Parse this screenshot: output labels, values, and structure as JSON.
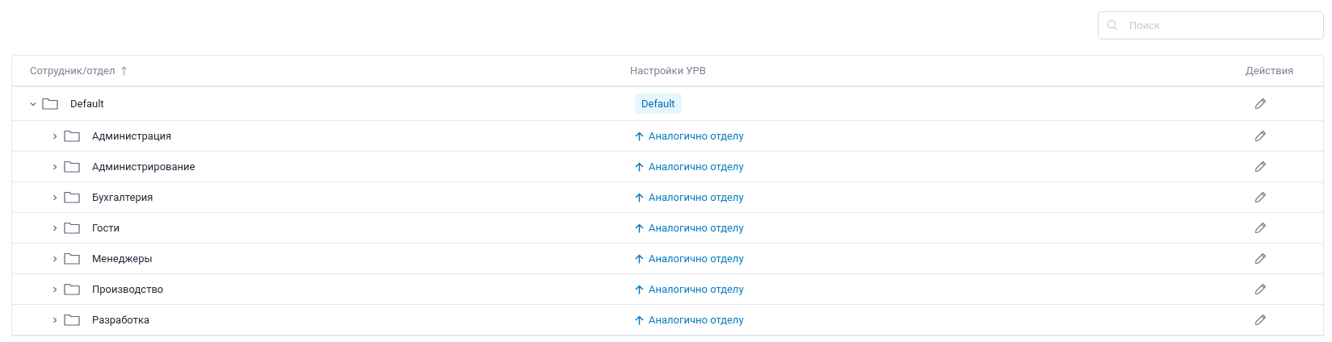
{
  "search": {
    "placeholder": "Поиск"
  },
  "table": {
    "columns": [
      {
        "label": "Сотрудник/отдел",
        "sort_ascending": true
      },
      {
        "label": "Настройки УРВ"
      },
      {
        "label": "Действия"
      }
    ],
    "rows": [
      {
        "name": "Default",
        "expanded": true,
        "setting": {
          "kind": "tag",
          "text": "Default"
        },
        "children": [
          {
            "name": "Администрация",
            "expanded": false,
            "setting": {
              "kind": "inherit",
              "text": "Аналогично отделу"
            }
          },
          {
            "name": "Администрирование",
            "expanded": false,
            "setting": {
              "kind": "inherit",
              "text": "Аналогично отделу"
            }
          },
          {
            "name": "Бухгалтерия",
            "expanded": false,
            "setting": {
              "kind": "inherit",
              "text": "Аналогично отделу"
            }
          },
          {
            "name": "Гости",
            "expanded": false,
            "setting": {
              "kind": "inherit",
              "text": "Аналогично отделу"
            }
          },
          {
            "name": "Менеджеры",
            "expanded": false,
            "setting": {
              "kind": "inherit",
              "text": "Аналогично отделу"
            }
          },
          {
            "name": "Производство",
            "expanded": false,
            "setting": {
              "kind": "inherit",
              "text": "Аналогично отделу"
            }
          },
          {
            "name": "Разработка",
            "expanded": false,
            "setting": {
              "kind": "inherit",
              "text": "Аналогично отделу"
            }
          }
        ]
      }
    ]
  }
}
